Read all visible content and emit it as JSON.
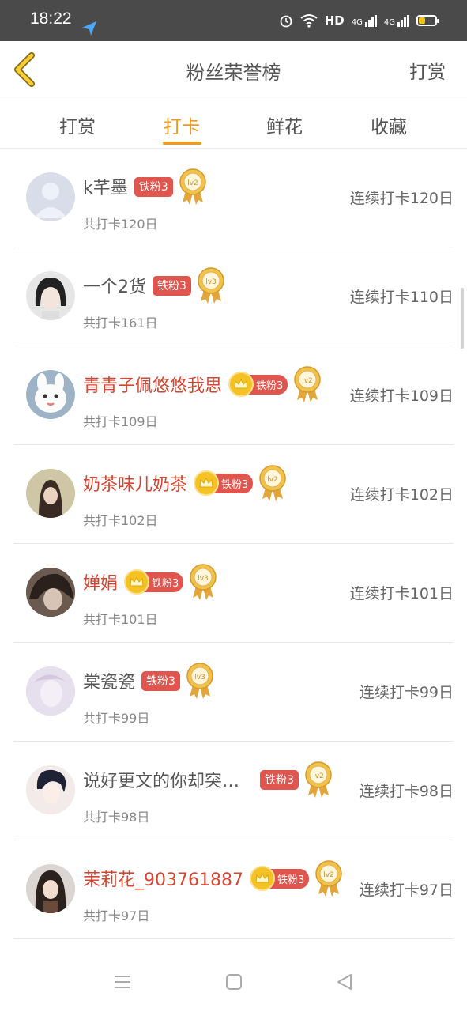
{
  "status_bar": {
    "time": "18:22",
    "network": "HD",
    "signal1": "4G",
    "signal2": "4G"
  },
  "header": {
    "title": "粉丝荣誉榜",
    "action": "打赏"
  },
  "tabs": [
    {
      "label": "打赏",
      "active": false
    },
    {
      "label": "打卡",
      "active": true
    },
    {
      "label": "鲜花",
      "active": false
    },
    {
      "label": "收藏",
      "active": false
    }
  ],
  "accent_color": "#f19b1c",
  "badge_color": "#e0564e",
  "rows": [
    {
      "name": "k芊墨",
      "badge": "铁粉3",
      "crown": false,
      "level": "lv2",
      "total": "共打卡120日",
      "streak": "连续打卡120日",
      "highlight": false
    },
    {
      "name": "一个2货",
      "badge": "铁粉3",
      "crown": false,
      "level": "lv3",
      "total": "共打卡161日",
      "streak": "连续打卡110日",
      "highlight": false
    },
    {
      "name": "青青子佩悠悠我思",
      "badge": "铁粉3",
      "crown": true,
      "level": "lv2",
      "total": "共打卡109日",
      "streak": "连续打卡109日",
      "highlight": true
    },
    {
      "name": "奶茶味儿奶茶",
      "badge": "铁粉3",
      "crown": true,
      "level": "lv2",
      "total": "共打卡102日",
      "streak": "连续打卡102日",
      "highlight": true
    },
    {
      "name": "婵娟",
      "badge": "铁粉3",
      "crown": true,
      "level": "lv3",
      "total": "共打卡101日",
      "streak": "连续打卡101日",
      "highlight": true
    },
    {
      "name": "棠瓷瓷",
      "badge": "铁粉3",
      "crown": false,
      "level": "lv3",
      "total": "共打卡99日",
      "streak": "连续打卡99日",
      "highlight": false
    },
    {
      "name": "说好更文的你却突…",
      "badge": "铁粉3",
      "crown": false,
      "level": "lv2",
      "total": "共打卡98日",
      "streak": "连续打卡98日",
      "highlight": false
    },
    {
      "name": "茉莉花_903761887",
      "badge": "铁粉3",
      "crown": true,
      "level": "lv2",
      "total": "共打卡97日",
      "streak": "连续打卡97日",
      "highlight": true
    }
  ],
  "system_nav": {
    "menu_icon": "menu-icon",
    "home_icon": "home-icon",
    "back_icon": "back-triangle-icon"
  }
}
